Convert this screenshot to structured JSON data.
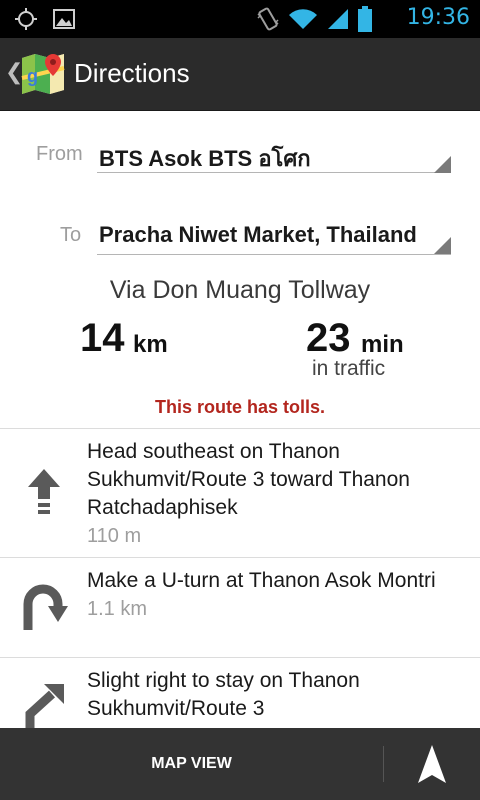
{
  "status_bar": {
    "time": "19:36",
    "icons": [
      "gps-icon",
      "gallery-icon",
      "vibrate-icon",
      "wifi-icon",
      "signal-icon",
      "battery-icon"
    ],
    "time_color": "#33b5e5"
  },
  "action_bar": {
    "title": "Directions",
    "app_icon": "maps-app-icon",
    "back_icon": "chevron-left-icon"
  },
  "form": {
    "from_label": "From",
    "from_value": "BTS Asok BTS อโศก",
    "to_label": "To",
    "to_value": "Pracha Niwet Market, Thailand"
  },
  "route": {
    "via": "Via Don Muang Tollway",
    "distance_value": "14",
    "distance_unit": "km",
    "time_value": "23",
    "time_unit": "min",
    "time_note": "in traffic",
    "warning": "This route has tolls.",
    "warning_color": "#b3261e"
  },
  "steps": [
    {
      "icon": "arrow-straight-icon",
      "instruction": "Head southeast on Thanon Sukhumvit/Route 3 toward Thanon Ratchadaphisek",
      "distance": "110 m"
    },
    {
      "icon": "u-turn-icon",
      "instruction": "Make a U-turn at Thanon Asok Montri",
      "distance": "1.1 km"
    },
    {
      "icon": "slight-right-icon",
      "instruction": "Slight right to stay on Thanon Sukhumvit/Route 3",
      "distance": ""
    }
  ],
  "bottom_bar": {
    "map_view_label": "MAP VIEW",
    "navigate_icon": "navigation-arrow-icon"
  }
}
